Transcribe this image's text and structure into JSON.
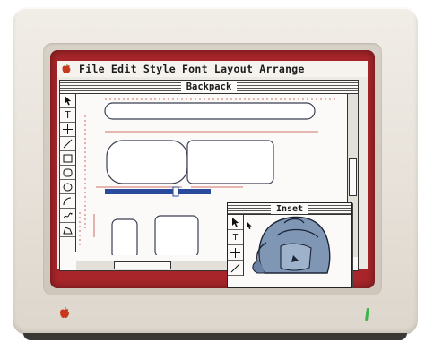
{
  "menubar": {
    "items": [
      "File",
      "Edit",
      "Style",
      "Font",
      "Layout",
      "Arrange"
    ]
  },
  "main_window": {
    "title": "Backpack"
  },
  "tools": {
    "items": [
      "pointer-tool",
      "text-tool",
      "crosshair-tool",
      "line-tool",
      "rectangle-tool",
      "rounded-rectangle-tool",
      "oval-tool",
      "arc-tool",
      "freehand-tool",
      "polygon-tool"
    ],
    "text_tool_glyph": "T"
  },
  "inset_window": {
    "title": "Inset",
    "text_tool_glyph": "T"
  },
  "colors": {
    "screen_border": "#a8262a",
    "monitor_case": "#e7e1d9",
    "selection_bar": "#2a4a9c",
    "backpack": "#7f97b5",
    "power_led": "#3bb54a"
  }
}
